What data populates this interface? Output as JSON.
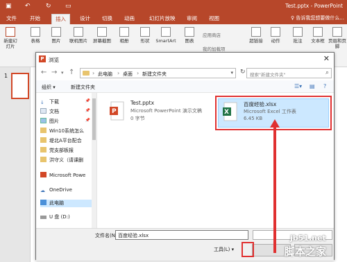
{
  "app": {
    "title": "Test.pptx - PowerPoint",
    "brand_color": "#b7472a",
    "tabs": [
      "文件",
      "开始",
      "插入",
      "设计",
      "切换",
      "动画",
      "幻灯片放映",
      "审阅",
      "视图"
    ],
    "active_tab": "插入",
    "tell_me": "♀ 告诉我您想要做什么..."
  },
  "ribbon": {
    "new_slide": "新建幻灯片",
    "table": "表格",
    "pictures": "图片",
    "online_pictures": "联机图片",
    "screenshot": "屏幕截图",
    "album": "相册",
    "shapes": "形状",
    "smartart": "SmartArt",
    "chart": "图表",
    "store": "应用商店",
    "my_addins": "我的加载项",
    "hyperlink": "超链接",
    "action": "动作",
    "comment": "批注",
    "textbox": "文本框",
    "header_footer": "页眉和页脚"
  },
  "slides": {
    "number": "1"
  },
  "dialog": {
    "title": "浏览",
    "breadcrumbs": [
      "此电脑",
      "桌面",
      "新建文件夹"
    ],
    "search_placeholder": "搜索\"新建文件夹\"",
    "organize": "组织 ▾",
    "new_folder": "新建文件夹",
    "nav_items": [
      {
        "label": "下载",
        "pinned": true
      },
      {
        "label": "文档",
        "pinned": true
      },
      {
        "label": "图片",
        "pinned": true
      },
      {
        "label": "Win10系统怎么",
        "pinned": false
      },
      {
        "label": "堤北A平台配合",
        "pinned": false
      },
      {
        "label": "党支部板报",
        "pinned": false
      },
      {
        "label": "洪守义（请课删",
        "pinned": false
      },
      {
        "label": "Microsoft Powe",
        "pinned": false
      },
      {
        "label": "OneDrive",
        "pinned": false
      },
      {
        "label": "此电脑",
        "pinned": false
      },
      {
        "label": "U 盘 (D:)",
        "pinned": false
      }
    ],
    "files": [
      {
        "name": "Test.pptx",
        "type": "Microsoft PowerPoint 演示文稿",
        "size": "0 字节",
        "icon": "pptx-icon"
      },
      {
        "name": "百度经验.xlsx",
        "type": "Microsoft Excel 工作表",
        "size": "6.45 KB",
        "icon": "xlsx-icon"
      }
    ],
    "filename_label": "文件名(N):",
    "filename_value": "百度经验.xlsx",
    "tools_label": "工具(L) ▾"
  },
  "watermark": {
    "url": "jb51.net",
    "name": "脚本之家"
  }
}
